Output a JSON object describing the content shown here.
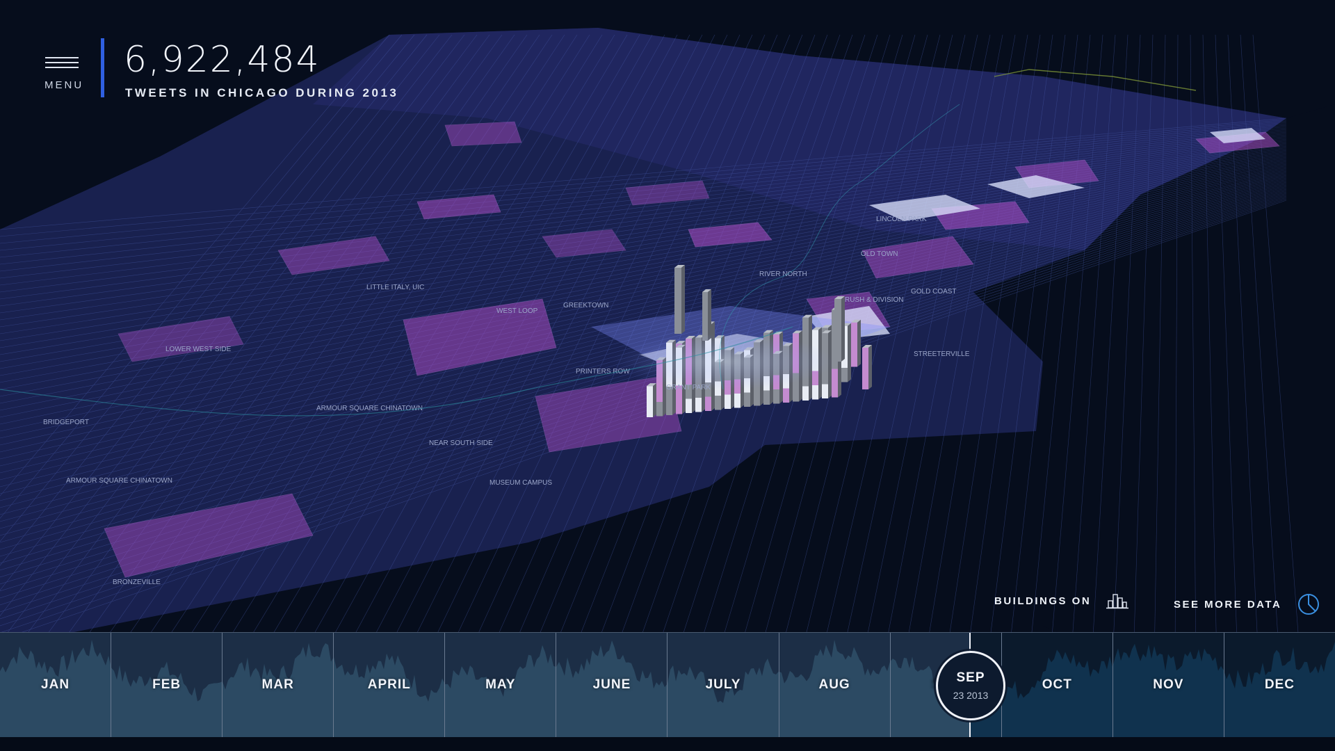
{
  "header": {
    "menu_label": "MENU",
    "tweet_count": "6,922,484",
    "subtitle": "TWEETS IN CHICAGO DURING 2013"
  },
  "map": {
    "neighborhoods": [
      "BRIDGEPORT",
      "ARMOUR SQUARE CHINATOWN",
      "ARMOUR SQUARE CHINATOWN",
      "BRONZEVILLE",
      "NEAR SOUTH SIDE",
      "MUSEUM CAMPUS",
      "LOWER WEST SIDE",
      "LITTLE ITALY, UIC",
      "WEST LOOP",
      "GREEKTOWN",
      "PRINTERS ROW",
      "GRANT PARK",
      "RIVER NORTH",
      "RUSH & DIVISION",
      "GOLD COAST",
      "STREETERVILLE",
      "OLD TOWN",
      "LINCOLN PARK"
    ],
    "colors": {
      "background": "#060d1c",
      "land": "#1d2456",
      "street_lines": "#4a5fb0",
      "highlight_purple": "#b04ec8",
      "highlight_white": "#dfe6ff",
      "buildings": "#8a8f98"
    }
  },
  "controls": {
    "buildings_label": "BUILDINGS ON",
    "buildings_icon": "buildings-icon",
    "data_label": "SEE MORE DATA",
    "data_icon": "pie-chart-icon"
  },
  "timeline": {
    "months": [
      "JAN",
      "FEB",
      "MAR",
      "APRIL",
      "MAY",
      "JUNE",
      "JULY",
      "AUG",
      "SEP",
      "OCT",
      "NOV",
      "DEC"
    ],
    "current": {
      "month": "SEP",
      "date": "23 2013"
    },
    "progress": 0.726,
    "colors": {
      "past": "#2c4a63",
      "future": "#10324e",
      "panel": "#1c2e46"
    }
  }
}
